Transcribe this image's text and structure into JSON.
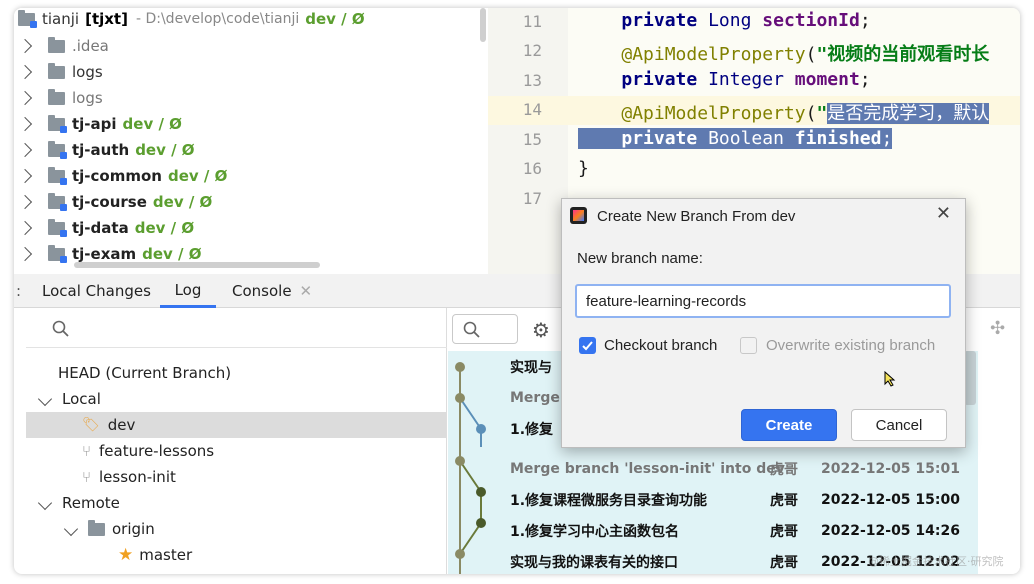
{
  "project": {
    "root": {
      "name": "tianji",
      "module": "[tjxt]",
      "path": "- D:\\develop\\code\\tianji",
      "branch": "dev / Ø"
    },
    "items": [
      {
        "name": ".idea",
        "branch": ""
      },
      {
        "name": "logs",
        "branch": ""
      },
      {
        "name": "tj-api",
        "branch": "dev / Ø"
      },
      {
        "name": "tj-auth",
        "branch": "dev / Ø"
      },
      {
        "name": "tj-common",
        "branch": "dev / Ø"
      },
      {
        "name": "tj-course",
        "branch": "dev / Ø"
      },
      {
        "name": "tj-data",
        "branch": "dev / Ø"
      },
      {
        "name": "tj-exam",
        "branch": "dev / Ø"
      }
    ]
  },
  "editor": {
    "lines": [
      {
        "n": "11",
        "text": "    private Long sectionId;"
      },
      {
        "n": "12",
        "text": "    @ApiModelProperty(\"视频的当前观看时长"
      },
      {
        "n": "13",
        "text": "    private Integer moment;"
      },
      {
        "n": "14",
        "text": "    @ApiModelProperty(\"是否完成学习，默认"
      },
      {
        "n": "15",
        "text": "    private Boolean finished;"
      },
      {
        "n": "16",
        "text": "}"
      },
      {
        "n": "17",
        "text": ""
      }
    ]
  },
  "tabs": {
    "local_changes": "Local Changes",
    "log": "Log",
    "console": "Console"
  },
  "branches": {
    "head": "HEAD (Current Branch)",
    "local": "Local",
    "dev": "dev",
    "feature_lessons": "feature-lessons",
    "lesson_init": "lesson-init",
    "remote": "Remote",
    "origin": "origin",
    "master": "master"
  },
  "log": {
    "rows": [
      {
        "msg": "实现与",
        "author": "",
        "date": ""
      },
      {
        "msg": "Merge",
        "author": "",
        "date": ""
      },
      {
        "msg": "1.修复",
        "author": "",
        "date": ""
      },
      {
        "msg": "Merge branch 'lesson-init' into dev",
        "author": "虎哥",
        "date": "2022-12-05 15:01"
      },
      {
        "msg": "1.修复课程微服务目录查询功能",
        "author": "虎哥",
        "date": "2022-12-05 15:00"
      },
      {
        "msg": "1.修复学习中心主函数包名",
        "author": "虎哥",
        "date": "2022-12-05 14:26"
      },
      {
        "msg": "实现与我的课表有关的接口",
        "author": "虎哥",
        "date": "2022-12-05 12:02"
      }
    ]
  },
  "dialog": {
    "title": "Create New Branch From dev",
    "label": "New branch name:",
    "value": "feature-learning-records",
    "checkout": "Checkout branch",
    "overwrite": "Overwrite existing branch",
    "create": "Create",
    "cancel": "Cancel"
  },
  "watermark": "@稀土掘金技术社区·研究院",
  "colors": {
    "accent": "#3574f0",
    "branch_green": "#5b9e2f",
    "selection": "#5f7ab0",
    "log_highlight": "#e0f3f6"
  }
}
